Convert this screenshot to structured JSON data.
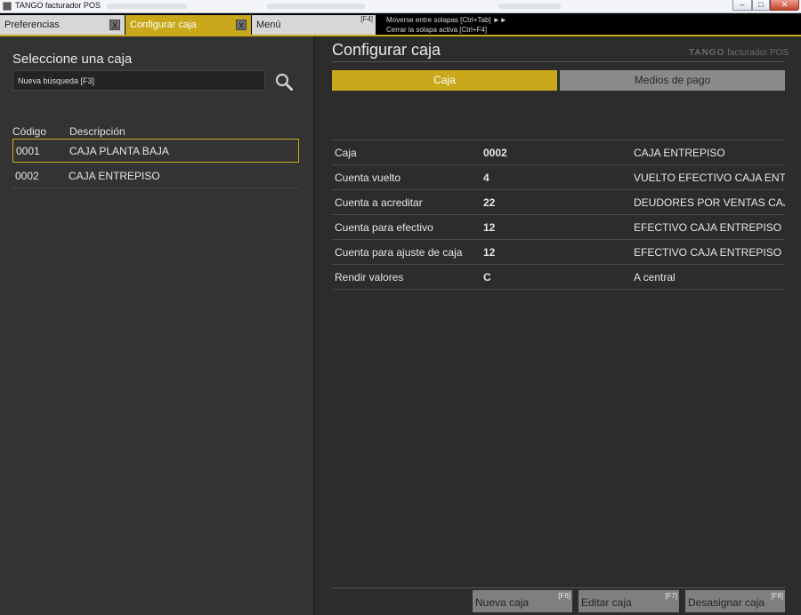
{
  "window": {
    "title": "TANGO facturador POS",
    "minimize_label": "–",
    "maximize_label": "□",
    "close_label": "✕"
  },
  "tabs": [
    {
      "label": "Preferencias",
      "close": "X"
    },
    {
      "label": "Configurar caja",
      "close": "X"
    },
    {
      "label": "Menú",
      "shortcut": "[F4]"
    }
  ],
  "hints": [
    "Moverse entre solapas [Ctrl+Tab] ►►",
    "Cerrar la solapa activa [Ctrl+F4]"
  ],
  "left": {
    "title": "Seleccione una caja",
    "search_placeholder": "Nueva búsqueda [F3]",
    "columns": {
      "code": "Código",
      "description": "Descripción"
    },
    "rows": [
      {
        "code": "0001",
        "description": "CAJA PLANTA BAJA",
        "selected": true
      },
      {
        "code": "0002",
        "description": "CAJA ENTREPISO",
        "selected": false
      }
    ]
  },
  "right": {
    "title": "Configurar caja",
    "brand": {
      "strong": "TANGO",
      "rest": "facturador POS"
    },
    "subtabs": [
      "Caja",
      "Medios de pago"
    ],
    "fields": [
      {
        "label": "Caja",
        "value": "0002",
        "description": "CAJA ENTREPISO"
      },
      {
        "label": "Cuenta vuelto",
        "value": "4",
        "description": "VUELTO EFECTIVO CAJA ENTREPISO"
      },
      {
        "label": "Cuenta a acreditar",
        "value": "22",
        "description": "DEUDORES POR VENTAS CAJA ENTREPISO"
      },
      {
        "label": "Cuenta para efectivo",
        "value": "12",
        "description": "EFECTIVO CAJA ENTREPISO"
      },
      {
        "label": "Cuenta para ajuste de caja",
        "value": "12",
        "description": "EFECTIVO CAJA ENTREPISO"
      },
      {
        "label": "Rendir valores",
        "value": "C",
        "description": "A central"
      }
    ],
    "actions": [
      {
        "label": "Nueva caja",
        "shortcut": "[F6]"
      },
      {
        "label": "Editar caja",
        "shortcut": "[F7]"
      },
      {
        "label": "Desasignar caja",
        "shortcut": "[F8]"
      }
    ]
  },
  "colors": {
    "accent": "#c9a81c",
    "tab_inactive": "#d7d7d7",
    "panel_left": "#333333",
    "panel_right": "#2c2c2c",
    "button": "#7f7f7f"
  }
}
